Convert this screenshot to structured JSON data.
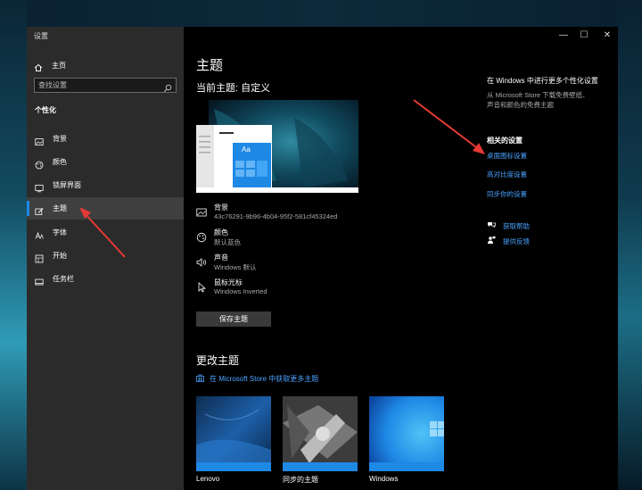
{
  "window": {
    "title": "设置",
    "controls": {
      "minimize": "—",
      "maximize": "☐",
      "close": "✕"
    }
  },
  "sidebar": {
    "home_label": "主页",
    "search_placeholder": "查找设置",
    "section_title": "个性化",
    "items": [
      {
        "label": "背景",
        "icon": "image-icon"
      },
      {
        "label": "颜色",
        "icon": "palette-icon"
      },
      {
        "label": "锁屏界面",
        "icon": "lock-screen-icon"
      },
      {
        "label": "主题",
        "icon": "brush-icon",
        "active": true
      },
      {
        "label": "字体",
        "icon": "font-icon"
      },
      {
        "label": "开始",
        "icon": "start-icon"
      },
      {
        "label": "任务栏",
        "icon": "taskbar-icon"
      }
    ]
  },
  "main": {
    "title": "主题",
    "current_theme": "当前主题: 自定义",
    "preview_tile_text": "Aa",
    "properties": [
      {
        "title": "背景",
        "value": "43c76291-9b96-4b04-95f2-581cf45324ed",
        "icon": "image-icon"
      },
      {
        "title": "颜色",
        "value": "默认蓝色",
        "icon": "palette-icon"
      },
      {
        "title": "声音",
        "value": "Windows 默认",
        "icon": "sound-icon"
      },
      {
        "title": "鼠标光标",
        "value": "Windows Inverted",
        "icon": "cursor-icon"
      }
    ],
    "save_button": "保存主题",
    "change_theme_title": "更改主题",
    "store_link": "在 Microsoft Store 中获取更多主题",
    "themes": [
      {
        "name": "Lenovo"
      },
      {
        "name": "同步的主题"
      },
      {
        "name": "Windows"
      }
    ]
  },
  "right_panel": {
    "store_title": "在 Windows 中进行更多个性化设置",
    "store_desc": "从 Microsoft Store 下载免费壁纸、声音和颜色的免费主题",
    "related_title": "相关的设置",
    "related_links": [
      "桌面图标设置",
      "高对比度设置",
      "同步你的设置"
    ],
    "help_links": [
      {
        "label": "获取帮助",
        "icon": "help-icon"
      },
      {
        "label": "提供反馈",
        "icon": "feedback-icon"
      }
    ]
  },
  "colors": {
    "accent": "#1e88e5",
    "link": "#4aa3ff",
    "sidebar_bg": "#2b2b2b",
    "arrow": "#e53935"
  }
}
